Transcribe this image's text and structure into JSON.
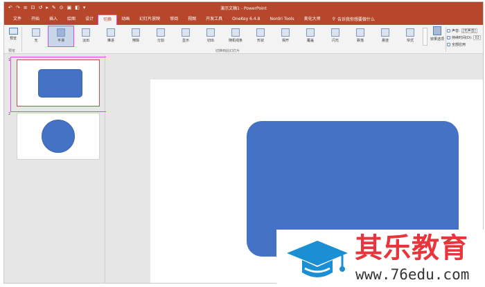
{
  "titlebar": {
    "title": "演示文稿1 - PowerPoint",
    "qat": [
      "↶",
      "↷",
      "≡",
      "⊡",
      "↺",
      "▸",
      "✎",
      "⊙",
      "▣",
      "◧",
      "▾"
    ]
  },
  "tabs": [
    {
      "label": "文件",
      "active": false
    },
    {
      "label": "开始",
      "active": false
    },
    {
      "label": "插入",
      "active": false
    },
    {
      "label": "绘图",
      "active": false
    },
    {
      "label": "设计",
      "active": false
    },
    {
      "label": "切换",
      "active": true
    },
    {
      "label": "动画",
      "active": false
    },
    {
      "label": "幻灯片放映",
      "active": false
    },
    {
      "label": "审阅",
      "active": false
    },
    {
      "label": "视图",
      "active": false
    },
    {
      "label": "开发工具",
      "active": false
    },
    {
      "label": "OneKey 6.4.8",
      "active": false
    },
    {
      "label": "Nordri Tools",
      "active": false
    },
    {
      "label": "美化大师",
      "active": false
    }
  ],
  "tellme": {
    "icon": "lightbulb-icon",
    "text": "告诉我你想要做什么"
  },
  "ribbon": {
    "preview_label": "预览",
    "preview_group_label": "预览",
    "transitions_group_label": "切换到此幻灯片",
    "effects": [
      "无",
      "平滑",
      "淡出",
      "推进",
      "擦除",
      "分割",
      "显示",
      "切出",
      "随机线条",
      "形状",
      "揭开",
      "覆盖",
      "闪光",
      "跌落",
      "悬挂",
      "帘式"
    ],
    "selected_effect": 1,
    "effect_options_label": "效果选项",
    "timing": {
      "sound_label": "声音:",
      "sound_value": "[无声音]",
      "duration_label": "持续时间(D):",
      "duration_value": "02",
      "apply_all_label": "全部应用"
    }
  },
  "thumbnails": [
    {
      "number": "1",
      "shape": "rounded-rectangle",
      "selected": true
    },
    {
      "number": "2",
      "shape": "circle",
      "selected": false
    }
  ],
  "colors": {
    "accent": "#b7472a",
    "shape_fill": "#4472c4",
    "highlight": "#e246e6",
    "watermark_red": "#e8343b",
    "watermark_blue": "#1a8fd3"
  },
  "watermark": {
    "title": "其乐教育",
    "url": "www.76edu.com",
    "icon": "graduation-cap-icon"
  }
}
